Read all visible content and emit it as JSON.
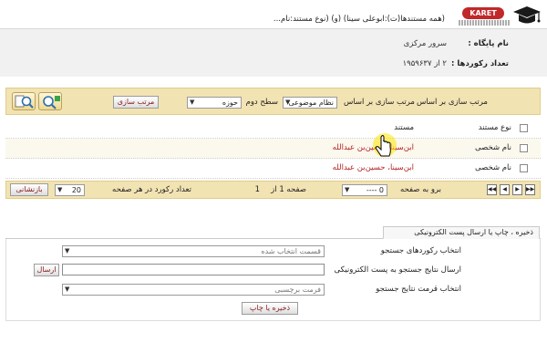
{
  "header": {
    "logo_text": "KARET",
    "query_text": "(همه مستندها(ت):ابوعلی سینا) (و) (نوع مستند:نام..."
  },
  "info": {
    "db_label": "نام پایگاه :",
    "db_value": "سرور مرکزی",
    "count_label": "تعداد رکوردها :",
    "count_value": "۲ از ۱۹۵۹۶۳۷"
  },
  "sortbar": {
    "label": "مرتب سازی بر اساس",
    "label2": "مرتب سازی بر اساس",
    "select1_value": "نظام موضوعی",
    "level2_label": "سطح دوم",
    "select2_value": "حوزه",
    "sort_button": "مرتب سازی"
  },
  "results": {
    "header_type": "نوع مستند",
    "header_doc": "مستند",
    "rows": [
      {
        "type": "نام شخصی",
        "doc": "ابن‌سینا، حسین‌بن عبدالله"
      },
      {
        "type": "نام شخصی",
        "doc": "ابن‌سینا، حسین‌بن عبدالله"
      }
    ]
  },
  "pagination": {
    "goto_label": "برو به صفحه",
    "goto_value": "0 ----",
    "page_text": "صفحه 1 از",
    "page_total": "1",
    "per_page_label": "تعداد رکورد در هر صفحه",
    "per_page_value": "20",
    "refresh_button": "بازنشانی"
  },
  "save_tab": {
    "tab_label": "ذخیره ، چاپ یا ارسال پست الکترونیکی",
    "select_records_label": "انتخاب رکوردهای جستجو",
    "select_records_value": "قسمت انتخاب شده",
    "email_label": "ارسال نتایج جستجو به پست الکترونیکی",
    "email_value": "",
    "send_button": "ارسال",
    "format_label": "انتخاب قرمت نتایج جستجو",
    "format_value": "فرمت برچسبی",
    "save_print_button": "ذخیره یا چاپ"
  },
  "colors": {
    "accent_red": "#c0282a",
    "toolbar_bg": "#f2e3b3",
    "link_red": "#b22222"
  }
}
